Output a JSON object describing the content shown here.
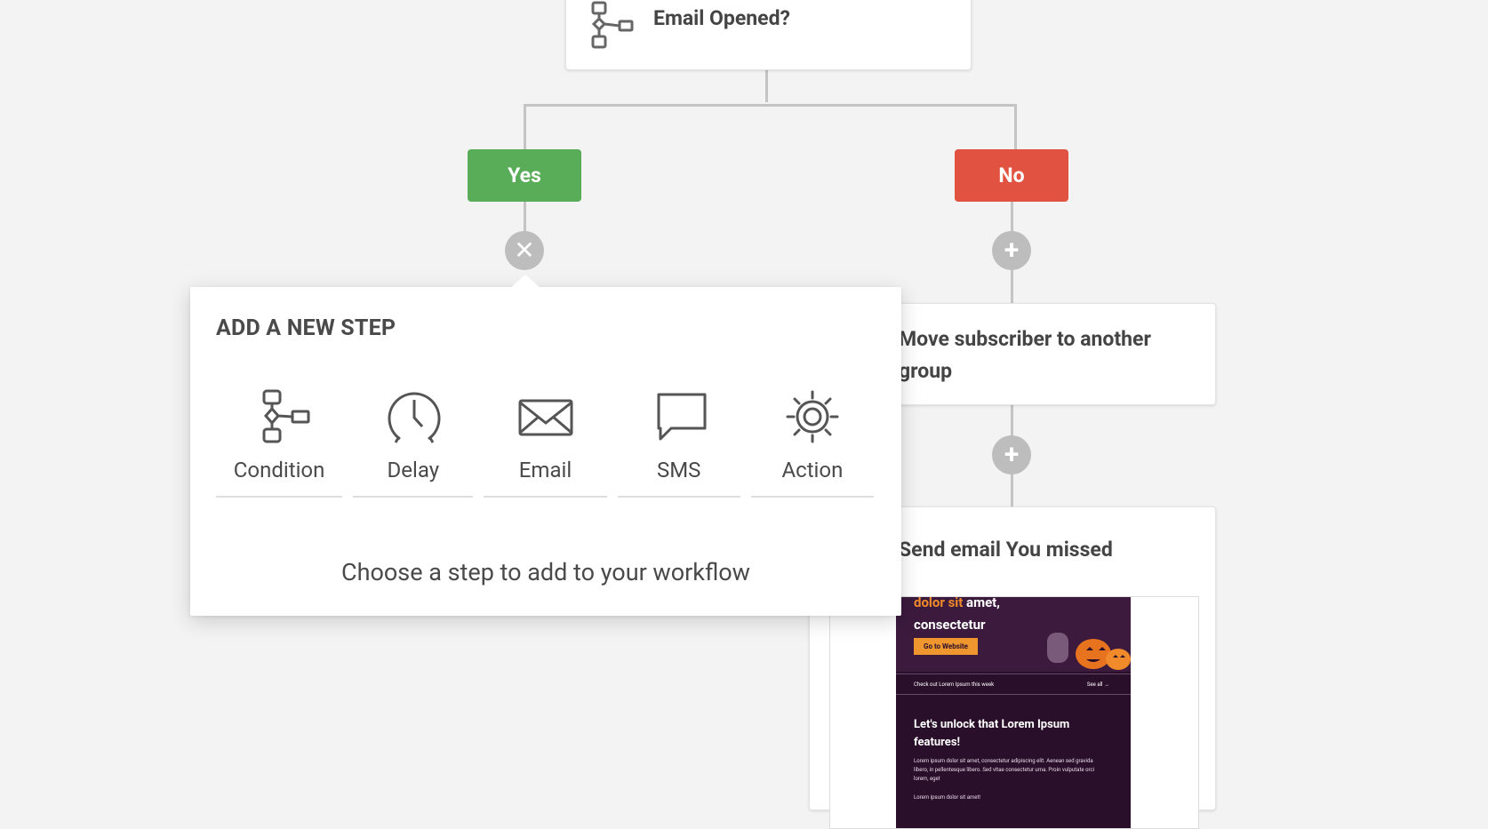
{
  "workflow": {
    "condition_node": {
      "title": "Email Opened?",
      "icon": "condition-icon"
    },
    "yes_label": "Yes",
    "no_label": "No",
    "move_step": {
      "title": "Move subscriber to another group"
    },
    "send_step": {
      "title": "Send email You missed"
    },
    "email_preview": {
      "headline_orange": "dolor sit",
      "headline_rest": " amet, consectetur",
      "button": "Go to Website",
      "bar_left": "Check out Lorem Ipsum this week",
      "bar_right": "See all →",
      "section_title": "Let's unlock that Lorem Ipsum features!",
      "body": "Lorem ipsum dolor sit amet, consectetur adipiscing elit. Aenean sed gravida libero, in pellentesque libero. Sed vitae consectetur urna. Proin vulputate orci lorem, eget",
      "body2": "Lorem ipsum dolor sit amet!"
    },
    "colors": {
      "yes": "#5aad58",
      "no": "#e25241",
      "connector": "#c4c4c4"
    }
  },
  "popup": {
    "title": "ADD A NEW STEP",
    "steps": [
      {
        "label": "Condition",
        "icon": "condition-icon"
      },
      {
        "label": "Delay",
        "icon": "clock-icon"
      },
      {
        "label": "Email",
        "icon": "envelope-icon"
      },
      {
        "label": "SMS",
        "icon": "chat-bubble-icon"
      },
      {
        "label": "Action",
        "icon": "gear-icon"
      }
    ],
    "hint": "Choose a step to add to your workflow"
  }
}
